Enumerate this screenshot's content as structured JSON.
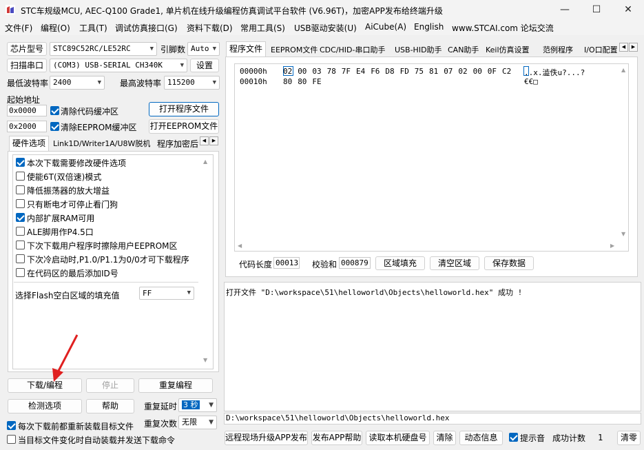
{
  "window": {
    "title": "STC车规级MCU, AEC-Q100 Grade1, 单片机在线升级编程仿真调试平台软件 (V6.96T)，加密APP发布给终端升级",
    "minimize": "—",
    "maximize": "☐",
    "close": "✕"
  },
  "menu": [
    "文件(F)",
    "编程(O)",
    "工具(T)",
    "调试仿真接口(G)",
    "资料下载(D)",
    "常用工具(S)",
    "USB驱动安装(U)",
    "AiCube(A)",
    "English",
    "www.STCAI.com 论坛交流"
  ],
  "left": {
    "chip_button": "芯片型号",
    "chip_value": "STC89C52RC/LE52RC",
    "pin_label": "引脚数",
    "pin_value": "Auto",
    "scan_button": "扫描串口",
    "port_value": "(COM3) USB-SERIAL CH340K",
    "settings_button": "设置",
    "min_baud_label": "最低波特率",
    "min_baud_value": "2400",
    "max_baud_label": "最高波特率",
    "max_baud_value": "115200",
    "start_addr_label": "起始地址",
    "code_addr": "0x0000",
    "clear_code": "清除代码缓冲区",
    "open_program": "打开程序文件",
    "eeprom_addr": "0x2000",
    "clear_eeprom": "清除EEPROM缓冲区",
    "open_eeprom": "打开EEPROM文件",
    "tabs": [
      "硬件选项",
      "Link1D/Writer1A/U8W脱机",
      "程序加密后"
    ],
    "options": [
      {
        "label": "本次下载需要修改硬件选项",
        "checked": true
      },
      {
        "label": "使能6T(双倍速)模式",
        "checked": false
      },
      {
        "label": "降低振荡器的放大增益",
        "checked": false
      },
      {
        "label": "只有断电才可停止看门狗",
        "checked": false
      },
      {
        "label": "内部扩展RAM可用",
        "checked": true
      },
      {
        "label": "ALE脚用作P4.5口",
        "checked": false
      },
      {
        "label": "下次下载用户程序时擦除用户EEPROM区",
        "checked": false
      },
      {
        "label": "下次冷启动时,P1.0/P1.1为0/0才可下载程序",
        "checked": false
      },
      {
        "label": "在代码区的最后添加ID号",
        "checked": false
      }
    ],
    "fill_label": "选择Flash空白区域的填充值",
    "fill_value": "FF",
    "download_button": "下载/编程",
    "stop_button": "停止",
    "reprogram_button": "重复编程",
    "check_button": "检测选项",
    "help_button": "帮助",
    "repeat_delay_label": "重复延时",
    "repeat_delay_value": "3 秒",
    "repeat_count_label": "重复次数",
    "repeat_count_value": "无限",
    "reload_label": "每次下载前都重新装载目标文件",
    "reload_checked": true,
    "auto_label": "当目标文件变化时自动装载并发送下载命令",
    "auto_checked": false
  },
  "right": {
    "tabs": [
      "程序文件",
      "EEPROM文件",
      "CDC/HID-串口助手",
      "USB-HID助手",
      "CAN助手",
      "Keil仿真设置",
      "范例程序",
      "I/O口配置"
    ],
    "hex_rows": [
      {
        "addr": "00000h",
        "bytes": [
          "02",
          "00",
          "03",
          "78",
          "7F",
          "E4",
          "F6",
          "D8",
          "FD",
          "75",
          "81",
          "07",
          "02",
          "00",
          "0F",
          "C2"
        ],
        "ascii": "..x.澁佚u?...?"
      },
      {
        "addr": "00010h",
        "bytes": [
          "80",
          "80",
          "FE"
        ],
        "ascii": "€€□"
      }
    ],
    "code_len_label": "代码长度",
    "code_len_value": "00013",
    "checksum_label": "校验和",
    "checksum_value": "000879",
    "fill_area_button": "区域填充",
    "clear_area_button": "清空区域",
    "save_button": "保存数据",
    "log": "打开文件 \"D:\\workspace\\51\\helloworld\\Objects\\helloworld.hex\" 成功 !",
    "file_path": "D:\\workspace\\51\\helloworld\\Objects\\helloworld.hex",
    "bottom_buttons": [
      "远程现场升级APP发布",
      "发布APP帮助",
      "读取本机硬盘号",
      "清除",
      "动态信息"
    ],
    "tip_label": "提示音",
    "tip_checked": true,
    "success_label": "成功计数",
    "success_value": "1",
    "clear_count_button": "清零"
  },
  "colors": {
    "accent": "#0067c0",
    "arrow": "#e02020"
  }
}
